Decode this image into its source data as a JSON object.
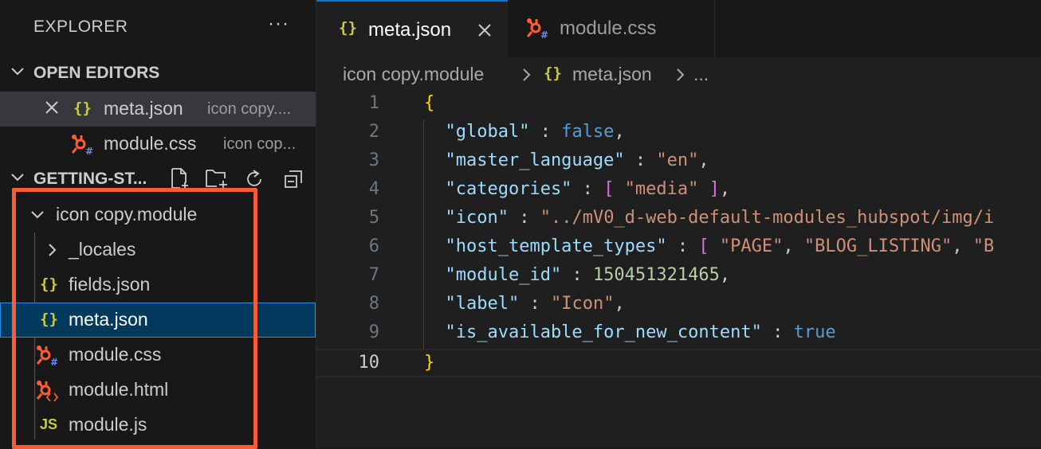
{
  "sidebar": {
    "title": "EXPLORER",
    "more_icon": "ellipsis-icon",
    "open_editors": {
      "header": "OPEN EDITORS",
      "items": [
        {
          "name": "meta.json",
          "description": "icon copy....",
          "icon": "json-icon"
        },
        {
          "name": "module.css",
          "description": "icon cop...",
          "icon": "hubspot-css-icon"
        }
      ]
    },
    "workspace": {
      "header": "GETTING-ST...",
      "actions": [
        "new-file-icon",
        "new-folder-icon",
        "refresh-icon",
        "collapse-all-icon"
      ],
      "folder": "icon copy.module",
      "items": [
        {
          "name": "_locales",
          "icon": "chevron-right-icon"
        },
        {
          "name": "fields.json",
          "icon": "json-icon"
        },
        {
          "name": "meta.json",
          "icon": "json-icon"
        },
        {
          "name": "module.css",
          "icon": "hubspot-css-icon"
        },
        {
          "name": "module.html",
          "icon": "hubspot-html-icon"
        },
        {
          "name": "module.js",
          "icon": "js-icon"
        }
      ]
    }
  },
  "icons": {
    "json": "{}",
    "js": "JS"
  },
  "colors": {
    "highlight": "#fa5a34",
    "selection": "#04395e",
    "accent": "#0078d4",
    "hubspot": "#ff5c35"
  },
  "tabs": [
    {
      "name": "meta.json",
      "active": true
    },
    {
      "name": "module.css",
      "active": false
    }
  ],
  "breadcrumb": [
    "icon copy.module",
    "meta.json",
    "..."
  ],
  "code": {
    "current_line": 10,
    "lines": [
      {
        "n": "1",
        "tokens": [
          [
            "br1",
            "{"
          ]
        ]
      },
      {
        "n": "2",
        "tokens": [
          [
            "k",
            "  \"global\""
          ],
          [
            "p",
            " : "
          ],
          [
            "b",
            "false"
          ],
          [
            "p",
            ","
          ]
        ]
      },
      {
        "n": "3",
        "tokens": [
          [
            "k",
            "  \"master_language\""
          ],
          [
            "p",
            " : "
          ],
          [
            "s",
            "\"en\""
          ],
          [
            "p",
            ","
          ]
        ]
      },
      {
        "n": "4",
        "tokens": [
          [
            "k",
            "  \"categories\""
          ],
          [
            "p",
            " : "
          ],
          [
            "br2",
            "["
          ],
          [
            "s",
            " \"media\" "
          ],
          [
            "br2",
            "]"
          ],
          [
            "p",
            ","
          ]
        ]
      },
      {
        "n": "5",
        "tokens": [
          [
            "k",
            "  \"icon\""
          ],
          [
            "p",
            " : "
          ],
          [
            "s",
            "\"../mV0_d-web-default-modules_hubspot/img/i"
          ]
        ]
      },
      {
        "n": "6",
        "tokens": [
          [
            "k",
            "  \"host_template_types\""
          ],
          [
            "p",
            " : "
          ],
          [
            "br2",
            "["
          ],
          [
            "s",
            " \"PAGE\""
          ],
          [
            "p",
            ", "
          ],
          [
            "s",
            "\"BLOG_LISTING\""
          ],
          [
            "p",
            ", "
          ],
          [
            "s",
            "\"B"
          ]
        ]
      },
      {
        "n": "7",
        "tokens": [
          [
            "k",
            "  \"module_id\""
          ],
          [
            "p",
            " : "
          ],
          [
            "n",
            "150451321465"
          ],
          [
            "p",
            ","
          ]
        ]
      },
      {
        "n": "8",
        "tokens": [
          [
            "k",
            "  \"label\""
          ],
          [
            "p",
            " : "
          ],
          [
            "s",
            "\"Icon\""
          ],
          [
            "p",
            ","
          ]
        ]
      },
      {
        "n": "9",
        "tokens": [
          [
            "k",
            "  \"is_available_for_new_content\""
          ],
          [
            "p",
            " : "
          ],
          [
            "b",
            "true"
          ]
        ]
      },
      {
        "n": "10",
        "tokens": [
          [
            "br1",
            "}"
          ]
        ]
      }
    ]
  }
}
